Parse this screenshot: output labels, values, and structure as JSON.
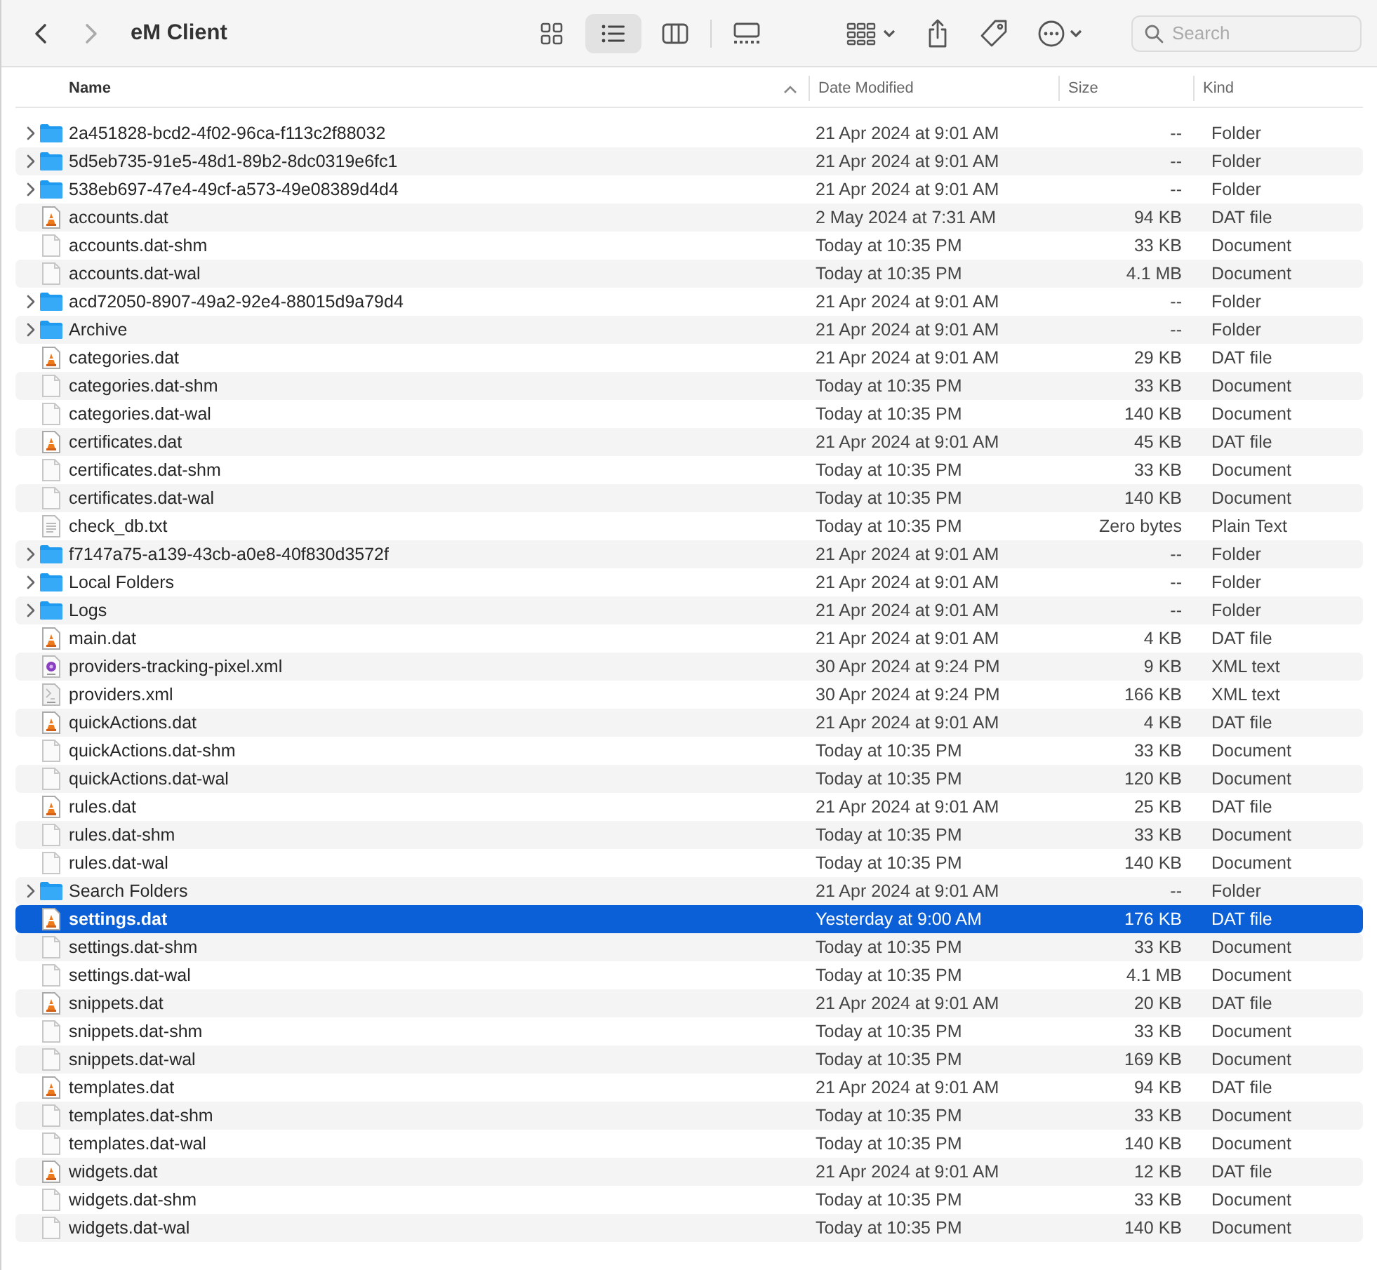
{
  "window": {
    "title": "eM Client"
  },
  "toolbar": {
    "views": [
      {
        "kind": "icons",
        "selected": false
      },
      {
        "kind": "list",
        "selected": true
      },
      {
        "kind": "columns",
        "selected": false
      },
      {
        "kind": "gallery",
        "selected": false
      }
    ],
    "search": {
      "placeholder": "Search"
    }
  },
  "table": {
    "columns": [
      {
        "label": "Name",
        "sorted": true
      },
      {
        "label": "Date Modified",
        "sorted": false
      },
      {
        "label": "Size",
        "sorted": false
      },
      {
        "label": "Kind",
        "sorted": false
      }
    ],
    "rows": [
      {
        "kind": "folder",
        "expanded": false,
        "name": "2a451828-bcd2-4f02-96ca-f113c2f88032",
        "date": "21 Apr 2024 at 9:01 AM",
        "size": "--",
        "type": "Folder",
        "selected": false
      },
      {
        "kind": "folder",
        "expanded": false,
        "name": "5d5eb735-91e5-48d1-89b2-8dc0319e6fc1",
        "date": "21 Apr 2024 at 9:01 AM",
        "size": "--",
        "type": "Folder",
        "selected": false
      },
      {
        "kind": "folder",
        "expanded": false,
        "name": "538eb697-47e4-49cf-a573-49e08389d4d4",
        "date": "21 Apr 2024 at 9:01 AM",
        "size": "--",
        "type": "Folder",
        "selected": false
      },
      {
        "kind": "dat",
        "name": "accounts.dat",
        "date": "2 May 2024 at 7:31 AM",
        "size": "94 KB",
        "type": "DAT file",
        "selected": false
      },
      {
        "kind": "blank",
        "name": "accounts.dat-shm",
        "date": "Today at 10:35 PM",
        "size": "33 KB",
        "type": "Document",
        "selected": false
      },
      {
        "kind": "blank",
        "name": "accounts.dat-wal",
        "date": "Today at 10:35 PM",
        "size": "4.1 MB",
        "type": "Document",
        "selected": false
      },
      {
        "kind": "folder",
        "expanded": false,
        "name": "acd72050-8907-49a2-92e4-88015d9a79d4",
        "date": "21 Apr 2024 at 9:01 AM",
        "size": "--",
        "type": "Folder",
        "selected": false
      },
      {
        "kind": "folder",
        "expanded": false,
        "name": "Archive",
        "date": "21 Apr 2024 at 9:01 AM",
        "size": "--",
        "type": "Folder",
        "selected": false
      },
      {
        "kind": "dat",
        "name": "categories.dat",
        "date": "21 Apr 2024 at 9:01 AM",
        "size": "29 KB",
        "type": "DAT file",
        "selected": false
      },
      {
        "kind": "blank",
        "name": "categories.dat-shm",
        "date": "Today at 10:35 PM",
        "size": "33 KB",
        "type": "Document",
        "selected": false
      },
      {
        "kind": "blank",
        "name": "categories.dat-wal",
        "date": "Today at 10:35 PM",
        "size": "140 KB",
        "type": "Document",
        "selected": false
      },
      {
        "kind": "dat",
        "name": "certificates.dat",
        "date": "21 Apr 2024 at 9:01 AM",
        "size": "45 KB",
        "type": "DAT file",
        "selected": false
      },
      {
        "kind": "blank",
        "name": "certificates.dat-shm",
        "date": "Today at 10:35 PM",
        "size": "33 KB",
        "type": "Document",
        "selected": false
      },
      {
        "kind": "blank",
        "name": "certificates.dat-wal",
        "date": "Today at 10:35 PM",
        "size": "140 KB",
        "type": "Document",
        "selected": false
      },
      {
        "kind": "text",
        "name": "check_db.txt",
        "date": "Today at 10:35 PM",
        "size": "Zero bytes",
        "type": "Plain Text",
        "selected": false
      },
      {
        "kind": "folder",
        "expanded": false,
        "name": "f7147a75-a139-43cb-a0e8-40f830d3572f",
        "date": "21 Apr 2024 at 9:01 AM",
        "size": "--",
        "type": "Folder",
        "selected": false
      },
      {
        "kind": "folder",
        "expanded": false,
        "name": "Local Folders",
        "date": "21 Apr 2024 at 9:01 AM",
        "size": "--",
        "type": "Folder",
        "selected": false
      },
      {
        "kind": "folder",
        "expanded": false,
        "name": "Logs",
        "date": "21 Apr 2024 at 9:01 AM",
        "size": "--",
        "type": "Folder",
        "selected": false
      },
      {
        "kind": "dat",
        "name": "main.dat",
        "date": "21 Apr 2024 at 9:01 AM",
        "size": "4 KB",
        "type": "DAT file",
        "selected": false
      },
      {
        "kind": "xml-badge",
        "name": "providers-tracking-pixel.xml",
        "date": "30 Apr 2024 at 9:24 PM",
        "size": "9 KB",
        "type": "XML text",
        "selected": false
      },
      {
        "kind": "xml",
        "name": "providers.xml",
        "date": "30 Apr 2024 at 9:24 PM",
        "size": "166 KB",
        "type": "XML text",
        "selected": false
      },
      {
        "kind": "dat",
        "name": "quickActions.dat",
        "date": "21 Apr 2024 at 9:01 AM",
        "size": "4 KB",
        "type": "DAT file",
        "selected": false
      },
      {
        "kind": "blank",
        "name": "quickActions.dat-shm",
        "date": "Today at 10:35 PM",
        "size": "33 KB",
        "type": "Document",
        "selected": false
      },
      {
        "kind": "blank",
        "name": "quickActions.dat-wal",
        "date": "Today at 10:35 PM",
        "size": "120 KB",
        "type": "Document",
        "selected": false
      },
      {
        "kind": "dat",
        "name": "rules.dat",
        "date": "21 Apr 2024 at 9:01 AM",
        "size": "25 KB",
        "type": "DAT file",
        "selected": false
      },
      {
        "kind": "blank",
        "name": "rules.dat-shm",
        "date": "Today at 10:35 PM",
        "size": "33 KB",
        "type": "Document",
        "selected": false
      },
      {
        "kind": "blank",
        "name": "rules.dat-wal",
        "date": "Today at 10:35 PM",
        "size": "140 KB",
        "type": "Document",
        "selected": false
      },
      {
        "kind": "folder",
        "expanded": false,
        "name": "Search Folders",
        "date": "21 Apr 2024 at 9:01 AM",
        "size": "--",
        "type": "Folder",
        "selected": false
      },
      {
        "kind": "dat",
        "name": "settings.dat",
        "date": "Yesterday at 9:00 AM",
        "size": "176 KB",
        "type": "DAT file",
        "selected": true
      },
      {
        "kind": "blank",
        "name": "settings.dat-shm",
        "date": "Today at 10:35 PM",
        "size": "33 KB",
        "type": "Document",
        "selected": false
      },
      {
        "kind": "blank",
        "name": "settings.dat-wal",
        "date": "Today at 10:35 PM",
        "size": "4.1 MB",
        "type": "Document",
        "selected": false
      },
      {
        "kind": "dat",
        "name": "snippets.dat",
        "date": "21 Apr 2024 at 9:01 AM",
        "size": "20 KB",
        "type": "DAT file",
        "selected": false
      },
      {
        "kind": "blank",
        "name": "snippets.dat-shm",
        "date": "Today at 10:35 PM",
        "size": "33 KB",
        "type": "Document",
        "selected": false
      },
      {
        "kind": "blank",
        "name": "snippets.dat-wal",
        "date": "Today at 10:35 PM",
        "size": "169 KB",
        "type": "Document",
        "selected": false
      },
      {
        "kind": "dat",
        "name": "templates.dat",
        "date": "21 Apr 2024 at 9:01 AM",
        "size": "94 KB",
        "type": "DAT file",
        "selected": false
      },
      {
        "kind": "blank",
        "name": "templates.dat-shm",
        "date": "Today at 10:35 PM",
        "size": "33 KB",
        "type": "Document",
        "selected": false
      },
      {
        "kind": "blank",
        "name": "templates.dat-wal",
        "date": "Today at 10:35 PM",
        "size": "140 KB",
        "type": "Document",
        "selected": false
      },
      {
        "kind": "dat",
        "name": "widgets.dat",
        "date": "21 Apr 2024 at 9:01 AM",
        "size": "12 KB",
        "type": "DAT file",
        "selected": false
      },
      {
        "kind": "blank",
        "name": "widgets.dat-shm",
        "date": "Today at 10:35 PM",
        "size": "33 KB",
        "type": "Document",
        "selected": false
      },
      {
        "kind": "blank",
        "name": "widgets.dat-wal",
        "date": "Today at 10:35 PM",
        "size": "140 KB",
        "type": "Document",
        "selected": false
      }
    ]
  }
}
